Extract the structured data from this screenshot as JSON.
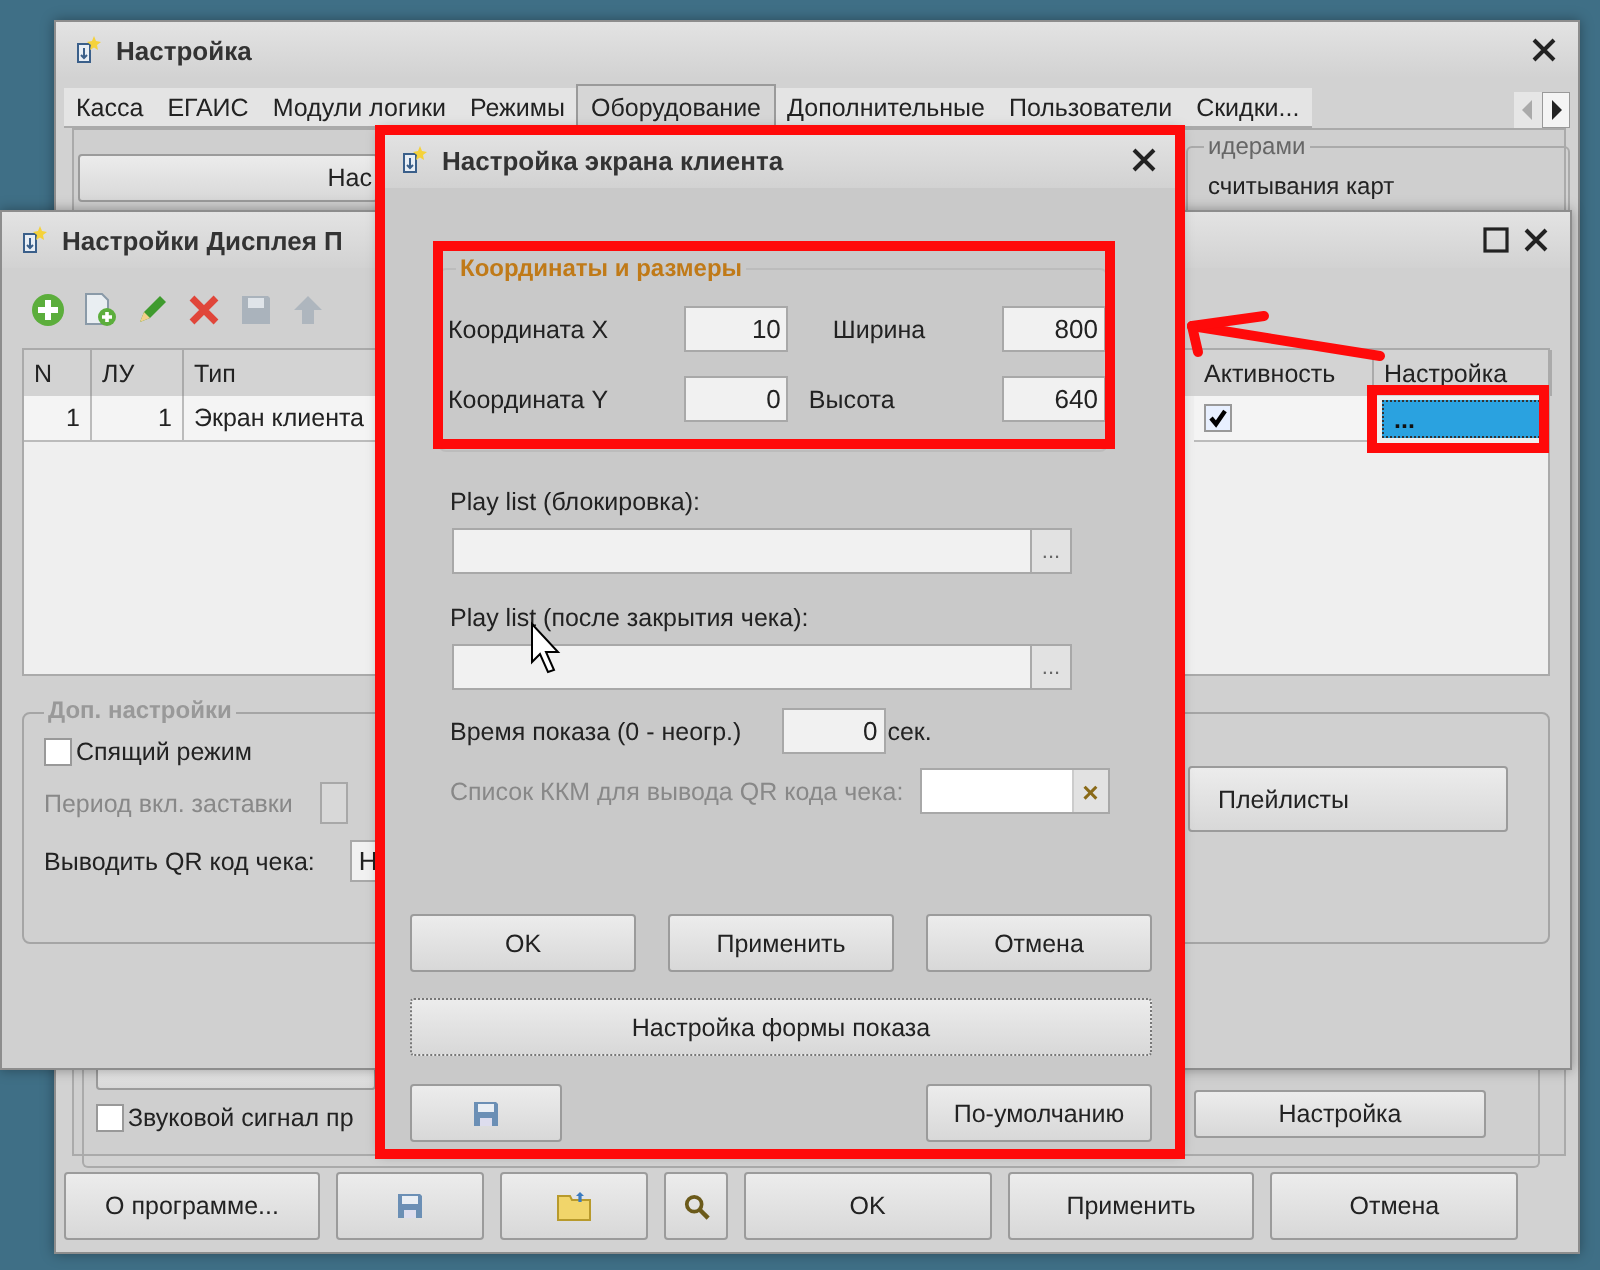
{
  "main_window": {
    "title": "Настройка",
    "tabs": [
      {
        "label": "Касса",
        "selected": false
      },
      {
        "label": "ЕГАИС",
        "selected": false
      },
      {
        "label": "Модули логики",
        "selected": false
      },
      {
        "label": "Режимы",
        "selected": false
      },
      {
        "label": "Оборудование",
        "selected": true
      },
      {
        "label": "Дополнительные",
        "selected": false
      },
      {
        "label": "Пользователи",
        "selected": false
      },
      {
        "label": "Скидки...",
        "selected": false
      }
    ],
    "panel_button": "Нас",
    "group_label": "идерами",
    "group_text": "считывания карт",
    "sound_checkbox": {
      "label": "Звуковой сигнал пр",
      "checked": false
    },
    "settings_button": "Настройка",
    "bottom_buttons": [
      {
        "kind": "text",
        "label": "О программе..."
      },
      {
        "kind": "save"
      },
      {
        "kind": "folder"
      },
      {
        "kind": "search"
      },
      {
        "kind": "text",
        "label": "OK"
      },
      {
        "kind": "text",
        "label": "Применить"
      },
      {
        "kind": "text",
        "label": "Отмена"
      }
    ]
  },
  "display_window": {
    "title": "Настройки Дисплея П",
    "toolbar": [
      {
        "kind": "add",
        "disabled": false
      },
      {
        "kind": "copy",
        "disabled": false
      },
      {
        "kind": "edit",
        "disabled": false
      },
      {
        "kind": "delete",
        "disabled": false
      },
      {
        "kind": "save",
        "disabled": true
      },
      {
        "kind": "up",
        "disabled": true
      }
    ],
    "table": {
      "columns": [
        "N",
        "ЛУ",
        "Тип",
        "Активность",
        "Настройка"
      ],
      "rows": [
        {
          "n": "1",
          "lu": "1",
          "type": "Экран клиента",
          "active": true,
          "setting": "...",
          "selected": true
        }
      ]
    },
    "extra_settings": {
      "title": "Доп. настройки",
      "sleep_mode": {
        "label": "Спящий режим",
        "checked": false
      },
      "screensaver_label": "Период вкл. заставки",
      "qr_label": "Выводить QR код чека:",
      "qr_value": "Н"
    },
    "playlists_button": "Плейлисты"
  },
  "dialog": {
    "title": "Настройка экрана клиента",
    "coords": {
      "title": "Координаты и размеры",
      "fields": [
        {
          "label": "Координата X",
          "value": "10"
        },
        {
          "label": "Ширина",
          "value": "800"
        },
        {
          "label": "Координата Y",
          "value": "0"
        },
        {
          "label": "Высота",
          "value": "640"
        }
      ]
    },
    "playlists": [
      {
        "label": "Play list (блокировка):",
        "browse": "..."
      },
      {
        "label": "Play list (после закрытия чека):",
        "browse": "..."
      }
    ],
    "show_time": {
      "label": "Время показа (0 - неогр.)",
      "value": "0",
      "unit": "сек."
    },
    "kkm_list": {
      "label": "Список ККМ для вывода QR кода чека:",
      "disabled": true,
      "clear": "×"
    },
    "buttons": [
      "OK",
      "Применить",
      "Отмена"
    ],
    "form_button": "Настройка формы показа",
    "default_button": "По-умолчанию"
  }
}
